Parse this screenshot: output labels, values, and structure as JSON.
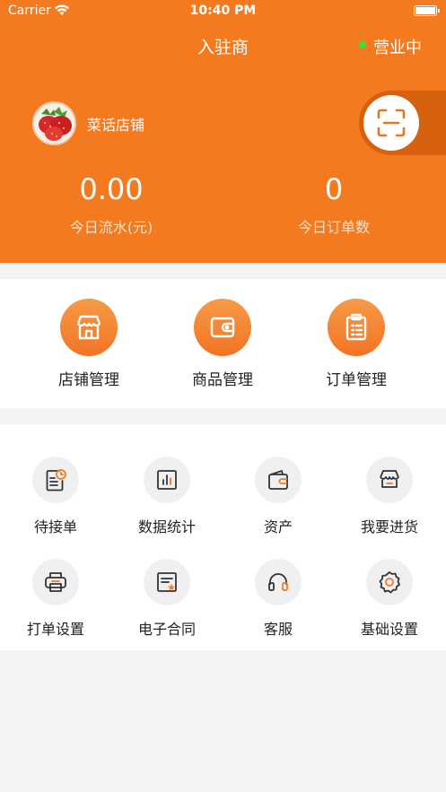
{
  "status_bar": {
    "carrier": "Carrier",
    "time": "10:40 PM"
  },
  "nav": {
    "title": "入驻商",
    "business_status": "营业中"
  },
  "store": {
    "name": "菜话店铺"
  },
  "stats": [
    {
      "value": "0.00",
      "label": "今日流水(元)"
    },
    {
      "value": "0",
      "label": "今日订单数"
    }
  ],
  "main_menu": [
    {
      "label": "店铺管理",
      "icon": "store-icon"
    },
    {
      "label": "商品管理",
      "icon": "wallet-icon"
    },
    {
      "label": "订单管理",
      "icon": "clipboard-icon"
    }
  ],
  "tools": [
    {
      "label": "待接单",
      "icon": "pending-order-icon"
    },
    {
      "label": "数据统计",
      "icon": "bar-chart-icon"
    },
    {
      "label": "资产",
      "icon": "wallet-icon"
    },
    {
      "label": "我要进货",
      "icon": "shop-icon"
    },
    {
      "label": "打单设置",
      "icon": "printer-icon"
    },
    {
      "label": "电子合同",
      "icon": "contract-icon"
    },
    {
      "label": "客服",
      "icon": "headset-icon"
    },
    {
      "label": "基础设置",
      "icon": "gear-icon"
    }
  ],
  "colors": {
    "brand": "#f47a20",
    "online": "#35e23c"
  }
}
